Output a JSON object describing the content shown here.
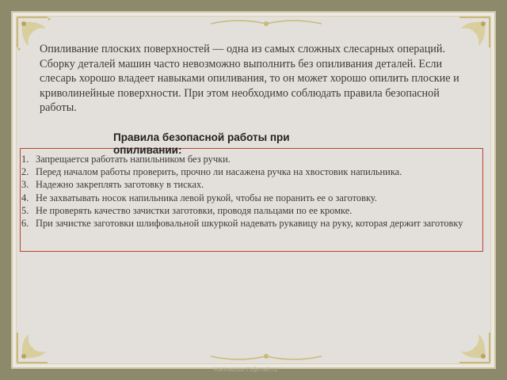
{
  "intro": {
    "lines": [
      "Опиливание плоских поверхностей — одна из самых сложных слесарных операций.",
      "Сборку деталей машин часто невозможно выполнить без опиливания деталей. Если",
      "слесарь хорошо владеет навыками опиливания, то он может хорошо опилить плоские и",
      "криволинейные поверхности. При этом необходимо соблюдать правила безопасной",
      "работы."
    ]
  },
  "rules": {
    "heading": "Правила безопасной работы при опиливании:",
    "items": [
      {
        "num": "1.",
        "text": "Запрещается  работать  напильником  без  ручки."
      },
      {
        "num": "2.",
        "text": "Перед началом работы проверить, прочно ли насажена ручка на хвостовик напильника."
      },
      {
        "num": "3.",
        "text": "Надежно закреплять заготовку в тисках."
      },
      {
        "num": "4.",
        "text": "Не захватывать носок напильника левой рукой, чтобы не поранить ее о заготовку."
      },
      {
        "num": "5.",
        "text": "Не проверять качество зачистки заготовки, проводя пальцами по ее кромке."
      },
      {
        "num": "6.",
        "text": "При зачистке заготовки шлифовальной шкуркой надевать рукавицу на руку, которая держит заготовку"
      }
    ]
  },
  "watermark": "FokinaLida.75@mail.ru",
  "colors": {
    "outer_frame": "#8d896b",
    "slide_background": "#e3e0db",
    "rules_border": "#b8432f",
    "text": "#3a3a3a"
  },
  "icons": {
    "corner_ornament": "ornate-corner-icon",
    "edge_ornament": "floral-ornament-icon"
  }
}
